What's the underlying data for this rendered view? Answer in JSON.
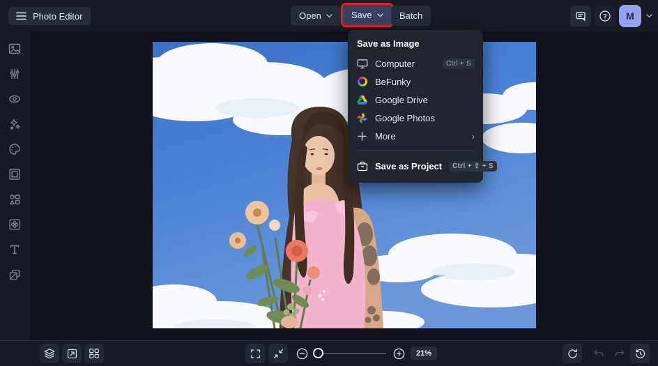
{
  "app": {
    "title": "Photo Editor"
  },
  "topbar": {
    "open_label": "Open",
    "save_label": "Save",
    "batch_label": "Batch",
    "avatar_initial": "M",
    "icons": [
      "hamburger-icon",
      "chevron-down-icon",
      "chat-icon",
      "help-icon"
    ]
  },
  "save_menu": {
    "header": "Save as Image",
    "items": [
      {
        "label": "Computer",
        "shortcut": "Ctrl + S",
        "icon": "computer-icon"
      },
      {
        "label": "BeFunky",
        "shortcut": "",
        "icon": "befunky-icon"
      },
      {
        "label": "Google Drive",
        "shortcut": "",
        "icon": "google-drive-icon"
      },
      {
        "label": "Google Photos",
        "shortcut": "",
        "icon": "google-photos-icon"
      },
      {
        "label": "More",
        "shortcut": "",
        "icon": "plus-icon",
        "arrow": "›"
      }
    ],
    "project": {
      "label": "Save as Project",
      "shortcut": "Ctrl + ⇧ + S",
      "icon": "save-project-icon"
    }
  },
  "sidebar": {
    "icons": [
      "image-manager-icon",
      "edit-adjust-icon",
      "touchup-eye-icon",
      "effects-sparkles-icon",
      "artsy-palette-icon",
      "frames-icon",
      "graphics-shapes-icon",
      "overlays-icon",
      "text-icon",
      "textures-icon"
    ]
  },
  "bottombar": {
    "zoom_value": "21%",
    "icons_left": [
      "layers-icon",
      "resize-icon",
      "grid-icon"
    ],
    "icons_center": [
      "fullscreen-icon",
      "fit-screen-icon",
      "zoom-out-icon",
      "zoom-in-icon"
    ],
    "icons_right": [
      "reset-icon",
      "undo-icon",
      "redo-icon",
      "history-icon"
    ]
  },
  "canvas": {
    "description": "Woman with long dark hair in a pink dress holding a flower bouquet against a blue sky with clouds"
  },
  "colors": {
    "highlight_red": "#e81e24",
    "save_button_bg": "#3c3f60",
    "avatar_bg": "#98a1ee",
    "topbar_bg": "#171a24",
    "canvas_bg": "#10131b",
    "menu_bg": "#21252f",
    "button_bg": "#262b38"
  }
}
